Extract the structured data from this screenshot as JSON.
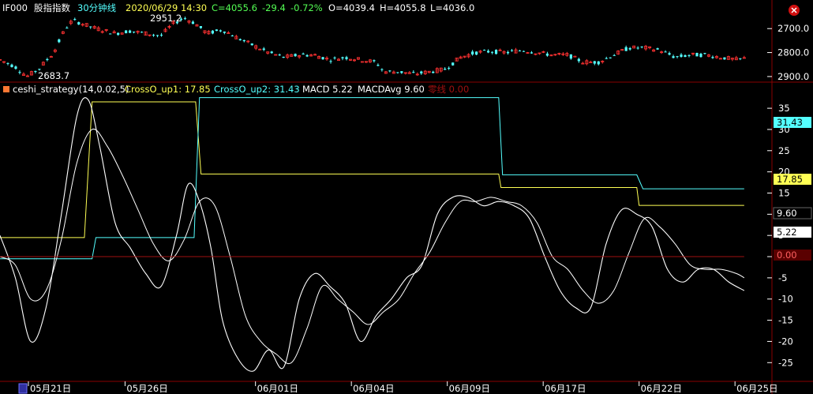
{
  "header": {
    "symbol": "IF000",
    "name": "股指指数",
    "period": "30分钟线",
    "datetime": "2020/06/29 14:30",
    "close": "C=4055.6",
    "change": "-29.4",
    "change_pct": "-0.72%",
    "open": "O=4039.4",
    "high": "H=4055.8",
    "low": "L=4036.0"
  },
  "indicator": {
    "name": "ceshi_strategy(14,0.02,5)",
    "crossup1_label": "CrossO_up1: 17.85",
    "crossup2_label": "CrossO_up2: 31.43",
    "macd_label": "MACD 5.22",
    "macdavg_label": "MACDAvg 9.60",
    "zero_label": "零线 0.00"
  },
  "price_panel": {
    "ticks": [
      "2900.0",
      "2800.0",
      "2700.0"
    ],
    "high_annotation": "2951.2",
    "low_annotation": "2683.7"
  },
  "indicator_panel": {
    "ticks": [
      "35",
      "30",
      "25",
      "20",
      "15",
      "10",
      "5",
      "0",
      "-5",
      "-10",
      "-15",
      "-20",
      "-25"
    ],
    "badges": {
      "crossup2": "31.43",
      "crossup1": "17.85",
      "macdavg": "9.60",
      "macd": "5.22",
      "zero": "0.00"
    }
  },
  "date_axis": [
    "05月21日",
    "05月26日",
    "06月01日",
    "06月04日",
    "06月09日",
    "06月17日",
    "06月22日",
    "06月25日"
  ],
  "colors": {
    "up": "#ff3232",
    "down": "#54ffff",
    "crossup1": "#ffff54",
    "crossup2": "#54ffff",
    "macd": "#ffffff",
    "zero": "#a01010",
    "grid": "#8a0000",
    "axis_text": "#ffffff"
  },
  "chart_data": [
    {
      "type": "candlestick",
      "title": "IF000 股指指数 30分钟线",
      "ylim": [
        2680,
        2960
      ],
      "y_ticks": [
        2700,
        2800,
        2900
      ],
      "annotations": [
        {
          "label": "2951.2"
        },
        {
          "label": "2683.7"
        }
      ]
    },
    {
      "type": "line",
      "title": "ceshi_strategy(14,0.02,5)",
      "ylim": [
        -27,
        38
      ],
      "y_ticks": [
        35,
        30,
        25,
        20,
        15,
        10,
        5,
        0,
        -5,
        -10,
        -15,
        -20,
        -25
      ],
      "series": [
        {
          "name": "CrossO_up1",
          "last": 17.85,
          "x": [
            0,
            0.11,
            0.12,
            0.255,
            0.262,
            0.65,
            0.653,
            0.83,
            0.833,
            0.97
          ],
          "y": [
            4.5,
            4.5,
            36.5,
            36.5,
            19.5,
            19.5,
            16.3,
            16.3,
            12.1,
            12.1
          ]
        },
        {
          "name": "CrossO_up2",
          "last": 31.43,
          "x": [
            0,
            0.12,
            0.125,
            0.253,
            0.26,
            0.65,
            0.655,
            0.83,
            0.838,
            0.97
          ],
          "y": [
            -0.5,
            -0.5,
            4.5,
            4.5,
            37.5,
            37.5,
            19.3,
            19.3,
            16,
            16
          ]
        },
        {
          "name": "MACD",
          "last": 5.22,
          "x": [
            0,
            0.02,
            0.04,
            0.06,
            0.08,
            0.1,
            0.115,
            0.13,
            0.15,
            0.17,
            0.19,
            0.21,
            0.23,
            0.245,
            0.26,
            0.275,
            0.29,
            0.31,
            0.33,
            0.35,
            0.37,
            0.39,
            0.41,
            0.43,
            0.45,
            0.47,
            0.49,
            0.51,
            0.53,
            0.55,
            0.57,
            0.59,
            0.61,
            0.63,
            0.65,
            0.67,
            0.69,
            0.71,
            0.73,
            0.75,
            0.77,
            0.79,
            0.81,
            0.83,
            0.85,
            0.87,
            0.89,
            0.91,
            0.93,
            0.95,
            0.97
          ],
          "y": [
            5,
            -5,
            -20,
            -12,
            10,
            33,
            37,
            26,
            8,
            2,
            -4,
            -7,
            5,
            17,
            13,
            2,
            -15,
            -24,
            -27,
            -22,
            -26,
            -10,
            -4,
            -7,
            -11,
            -20,
            -14,
            -10,
            -5,
            -2,
            10,
            14,
            14,
            12,
            13,
            12,
            9,
            0,
            -8,
            -12,
            -12,
            3,
            11,
            10,
            7,
            -3,
            -6,
            -3,
            -3,
            -6,
            -8
          ]
        },
        {
          "name": "MACDAvg",
          "last": 9.6,
          "x": [
            0,
            0.02,
            0.04,
            0.06,
            0.08,
            0.1,
            0.12,
            0.14,
            0.16,
            0.18,
            0.2,
            0.22,
            0.24,
            0.26,
            0.28,
            0.3,
            0.32,
            0.34,
            0.36,
            0.38,
            0.4,
            0.42,
            0.44,
            0.46,
            0.48,
            0.5,
            0.52,
            0.54,
            0.56,
            0.58,
            0.6,
            0.62,
            0.64,
            0.66,
            0.68,
            0.7,
            0.72,
            0.74,
            0.76,
            0.78,
            0.8,
            0.82,
            0.84,
            0.86,
            0.88,
            0.9,
            0.92,
            0.94,
            0.96,
            0.97
          ],
          "y": [
            0,
            -2,
            -10,
            -8,
            4,
            22,
            30,
            26,
            19,
            11,
            3,
            -1,
            4,
            13,
            12,
            0,
            -14,
            -20,
            -23,
            -25,
            -17,
            -7,
            -10,
            -13,
            -16,
            -13,
            -10,
            -4,
            1,
            8,
            13,
            13,
            14,
            13,
            12,
            8,
            0,
            -3,
            -8,
            -11,
            -8,
            1,
            9,
            7,
            3,
            -2,
            -3,
            -3,
            -4,
            -5
          ]
        },
        {
          "name": "零线",
          "last": 0.0,
          "x": [
            0,
            0.97
          ],
          "y": [
            0,
            0
          ]
        }
      ]
    }
  ]
}
